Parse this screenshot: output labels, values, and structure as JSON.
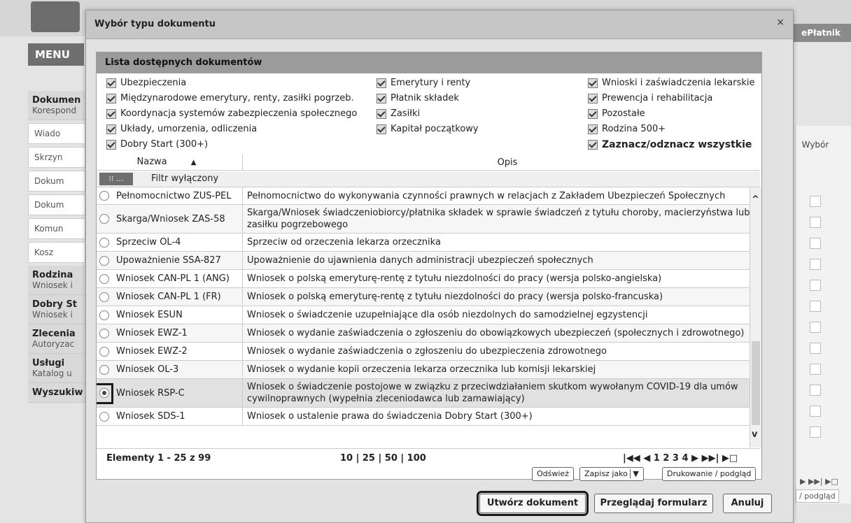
{
  "background": {
    "menu_label": "MENU",
    "eplatnik_label": "ePłatnik",
    "sidebar": [
      {
        "title": "Dokumen",
        "sub": "Korespond"
      },
      {
        "title": "",
        "sub": ""
      }
    ],
    "sidebar_items": [
      "Wiado",
      "Skrzyn",
      "Dokum",
      "Dokum",
      "Komun",
      "Kosz"
    ],
    "sidebar_sections": [
      {
        "title": "Rodzina",
        "sub": "Wniosek i"
      },
      {
        "title": "Dobry St",
        "sub": "Wniosek i"
      },
      {
        "title": "Zlecenia",
        "sub": "Autoryzac"
      },
      {
        "title": "Usługi",
        "sub": "Katalog u"
      },
      {
        "title": "Wyszukiw",
        "sub": ""
      }
    ],
    "right_wybor": "Wybór",
    "right_pager": "▶ ▶▶|   ▶□",
    "right_podglad": "/ podgląd"
  },
  "dialog": {
    "title": "Wybór typu dokumentu",
    "close": "×",
    "panel_title": "Lista dostępnych dokumentów",
    "categories": [
      "Ubezpieczenia",
      "Międzynarodowe emerytury, renty, zasiłki pogrzeb.",
      "Koordynacja systemów zabezpieczenia społecznego",
      "Układy, umorzenia, odliczenia",
      "Dobry Start (300+)",
      "Emerytury i renty",
      "Płatnik składek",
      "Zasiłki",
      "Kapitał początkowy",
      "Wnioski i zaświadczenia lekarskie",
      "Prewencja i rehabilitacja",
      "Pozostałe",
      "Rodzina 500+",
      "Zaznacz/odznacz wszystkie"
    ],
    "col_nazwa": "Nazwa",
    "col_opis": "Opis",
    "sort_icon": "▲",
    "filter_button": "⁝⁝ ...",
    "filter_label": "Filtr wyłączony",
    "rows": [
      {
        "name": "Pełnomocnictwo ZUS-PEL",
        "desc": "Pełnomocnictwo do wykonywania czynności prawnych w relacjach z Zakładem Ubezpieczeń Społecznych"
      },
      {
        "name": "Skarga/Wniosek ZAS-58",
        "desc": "Skarga/Wniosek świadczeniobiorcy/płatnika składek w sprawie świadczeń z tytułu choroby, macierzyństwa lub zasiłku pogrzebowego"
      },
      {
        "name": "Sprzeciw OL-4",
        "desc": "Sprzeciw od orzeczenia lekarza orzecznika"
      },
      {
        "name": "Upoważnienie SSA-827",
        "desc": "Upoważnienie do ujawnienia danych administracji ubezpieczeń społecznych"
      },
      {
        "name": "Wniosek CAN-PL 1 (ANG)",
        "desc": "Wniosek o polską emeryturę-rentę z tytułu niezdolności do pracy (wersja polsko-angielska)"
      },
      {
        "name": "Wniosek CAN-PL 1 (FR)",
        "desc": "Wniosek o polską emeryturę-rentę z tytułu niezdolności do pracy (wersja polsko-francuska)"
      },
      {
        "name": "Wniosek ESUN",
        "desc": "Wniosek o świadczenie uzupełniające dla osób niezdolnych do samodzielnej egzystencji"
      },
      {
        "name": "Wniosek EWZ-1",
        "desc": "Wniosek o wydanie zaświadczenia o zgłoszeniu do obowiązkowych ubezpieczeń (społecznych i zdrowotnego)"
      },
      {
        "name": "Wniosek EWZ-2",
        "desc": "Wniosek o wydanie zaświadczenia o zgłoszeniu do ubezpieczenia zdrowotnego"
      },
      {
        "name": "Wniosek OL-3",
        "desc": "Wniosek o wydanie kopii orzeczenia lekarza orzecznika lub komisji lekarskiej"
      },
      {
        "name": "Wniosek RSP-C",
        "desc": "Wniosek o świadczenie postojowe w związku z przeciwdziałaniem skutkom wywołanym COVID-19 dla umów cywilnoprawnych (wypełnia zleceniodawca lub zamawiający)"
      },
      {
        "name": "Wniosek SDS-1",
        "desc": "Wniosek o ustalenie prawa do świadczenia Dobry Start (300+)"
      }
    ],
    "scroll_up": "^",
    "scroll_down": "v",
    "elements_count": "Elementy 1 - 25 z 99",
    "page_sizes": "10 | 25 | 50 | 100",
    "page_nav": "|◀◀   ◀   1 2 3 4   ▶ ▶▶|   ▶□",
    "btn_refresh": "Odśwież",
    "btn_save_as": "Zapisz jako",
    "btn_save_as_arrow": "▼",
    "btn_print": "Drukowanie / podgląd",
    "btn_create": "Utwórz dokument",
    "btn_browse": "Przeglądaj formularz",
    "btn_cancel": "Anuluj"
  }
}
